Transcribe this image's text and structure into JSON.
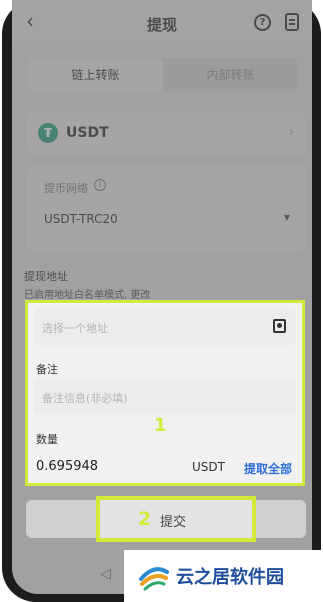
{
  "header": {
    "title": "提现",
    "back_icon": "back-arrow-icon",
    "help_icon": "help-icon",
    "record_icon": "record-icon"
  },
  "tabs": [
    {
      "label": "链上转账",
      "active": true
    },
    {
      "label": "内部转账",
      "active": false
    }
  ],
  "coin": {
    "name": "USDT",
    "icon": "tether-icon",
    "icon_glyph": "₮",
    "chevron": "›"
  },
  "network": {
    "label": "提币网络",
    "value": "USDT-TRC20",
    "caret": "▾"
  },
  "address": {
    "label": "提现地址",
    "hint": "已启用地址白名单模式, 更改",
    "placeholder": "选择一个地址"
  },
  "remark": {
    "label": "备注",
    "placeholder": "备注信息(非必填)"
  },
  "quantity": {
    "label": "数量",
    "value": "0.695948",
    "unit": "USDT",
    "withdraw_all": "提取全部"
  },
  "submit": {
    "label": "提交"
  },
  "annotations": {
    "marker_1": "1",
    "marker_2": "2",
    "highlight_color": "#d3ea3a"
  },
  "nav": {
    "back_glyph": "◁"
  },
  "watermark": {
    "text": "云之居软件园"
  }
}
